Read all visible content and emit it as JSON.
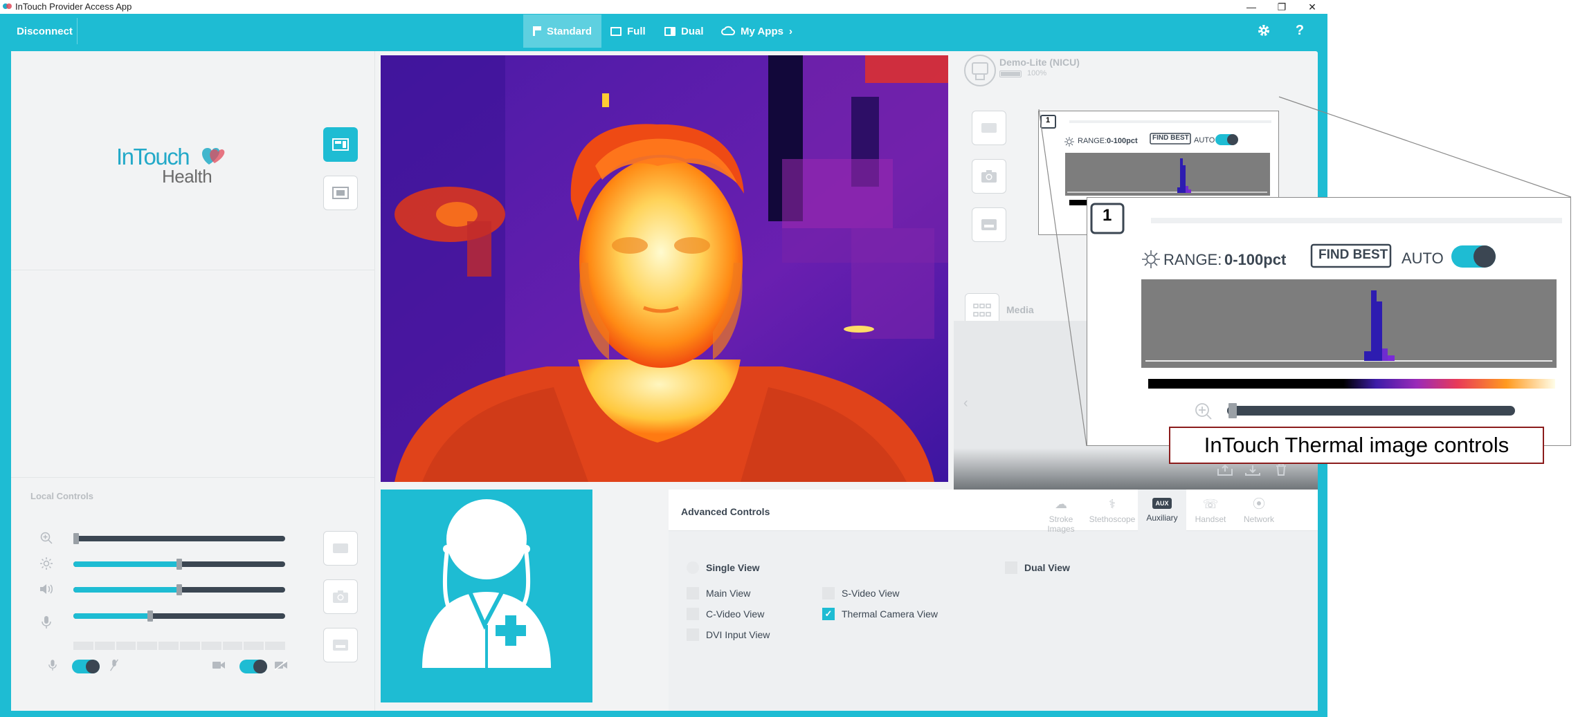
{
  "window": {
    "title": "InTouch Provider Access App",
    "controls": {
      "minimize": "—",
      "restore": "❐",
      "close": "✕"
    }
  },
  "topbar": {
    "disconnect_label": "Disconnect",
    "views": [
      {
        "label": "Standard",
        "active": true
      },
      {
        "label": "Full",
        "active": false
      },
      {
        "label": "Dual",
        "active": false
      },
      {
        "label": "My Apps",
        "active": false
      }
    ],
    "my_apps_chevron": "›",
    "help_label": "?",
    "icons": {
      "settings": "gear-icon",
      "help": "help-icon"
    }
  },
  "brand": {
    "name_main": "InTouch",
    "name_sub": "Health"
  },
  "local_controls": {
    "title": "Local Controls",
    "sliders": [
      {
        "name": "zoom",
        "icon": "zoom-in-icon",
        "value": 0.0
      },
      {
        "name": "brightness",
        "icon": "brightness-icon",
        "value": 0.5
      },
      {
        "name": "volume",
        "icon": "speaker-icon",
        "value": 0.5
      },
      {
        "name": "mic-gain",
        "icon": "microphone-icon",
        "value": 0.36
      }
    ],
    "side_buttons": [
      "zoom-button",
      "snapshot-button",
      "record-button"
    ],
    "mic_toggle_on": true,
    "camera_toggle_on": true
  },
  "device": {
    "name": "Demo-Lite (NICU)",
    "battery_pct": "100%",
    "battery_level": 1.0
  },
  "media": {
    "label": "Media"
  },
  "thermal_small": {
    "index": "1",
    "range_label": "RANGE:",
    "range_value": "0-100pct",
    "find_best_label": "FIND BEST",
    "auto_label": "AUTO",
    "auto_on": true
  },
  "thermal_zoom": {
    "index": "1",
    "range_label": "RANGE:",
    "range_value": "0-100pct",
    "find_best_label": "FIND BEST",
    "auto_label": "AUTO",
    "auto_on": true,
    "zoom_level": 0.0
  },
  "advanced": {
    "title": "Advanced Controls",
    "tabs": [
      {
        "label": "Stroke Images",
        "icon": "cloud-icon",
        "active": false
      },
      {
        "label": "Stethoscope",
        "icon": "stethoscope-icon",
        "active": false
      },
      {
        "label": "Auxiliary",
        "icon": "aux-icon",
        "chip": "AUX",
        "active": true
      },
      {
        "label": "Handset",
        "icon": "handset-icon",
        "active": false
      },
      {
        "label": "Network",
        "icon": "network-icon",
        "active": false
      }
    ],
    "modes": {
      "single": "Single View",
      "dual": "Dual View"
    },
    "options": [
      {
        "label": "Main View",
        "checked": false
      },
      {
        "label": "C-Video View",
        "checked": false
      },
      {
        "label": "DVI Input View",
        "checked": false
      },
      {
        "label": "S-Video View",
        "checked": false
      },
      {
        "label": "Thermal Camera View",
        "checked": true
      }
    ]
  },
  "annotation": {
    "text": "InTouch Thermal image controls"
  },
  "colors": {
    "accent": "#1ebcd3",
    "dark": "#3b4652",
    "callout_border": "#8b1c1c"
  }
}
